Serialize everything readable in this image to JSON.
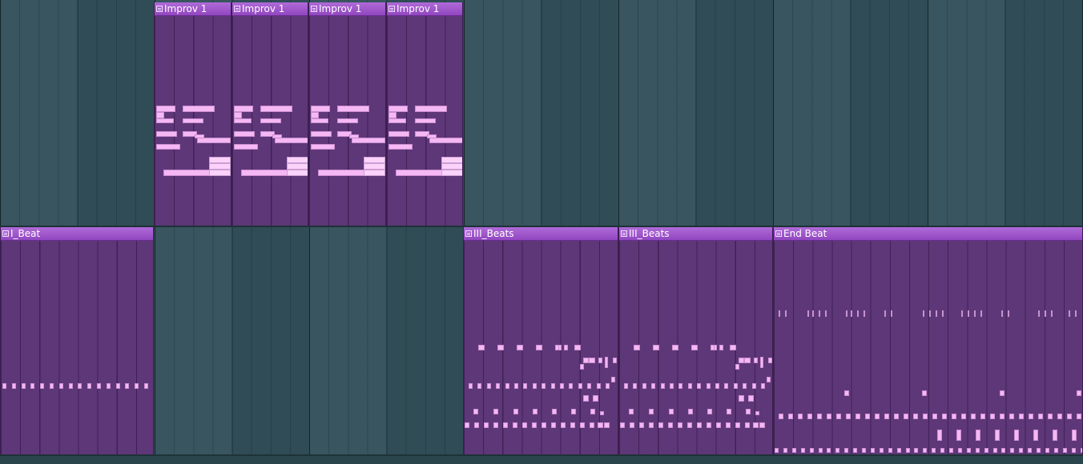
{
  "playlist": {
    "tracks": [
      {
        "id": "track-1",
        "clips": [
          {
            "name": "Improv 1",
            "pattern": "improv"
          },
          {
            "name": "Improv 1",
            "pattern": "improv"
          },
          {
            "name": "Improv 1",
            "pattern": "improv"
          },
          {
            "name": "Improv 1",
            "pattern": "improv"
          }
        ]
      },
      {
        "id": "track-2",
        "clips": [
          {
            "name": "I_Beat",
            "pattern": "i_beat"
          },
          {
            "name": "III_Beats",
            "pattern": "iii_beats"
          },
          {
            "name": "III_Beats",
            "pattern": "iii_beats"
          },
          {
            "name": "End Beat",
            "pattern": "end_beat"
          }
        ]
      }
    ]
  },
  "colors": {
    "grid_background": "#33505a",
    "clip_body": "#5e3778",
    "clip_header": "#a45bcf",
    "note": "#f5b8f4"
  },
  "icons": {
    "clip_icon": "pattern-clip-icon"
  }
}
